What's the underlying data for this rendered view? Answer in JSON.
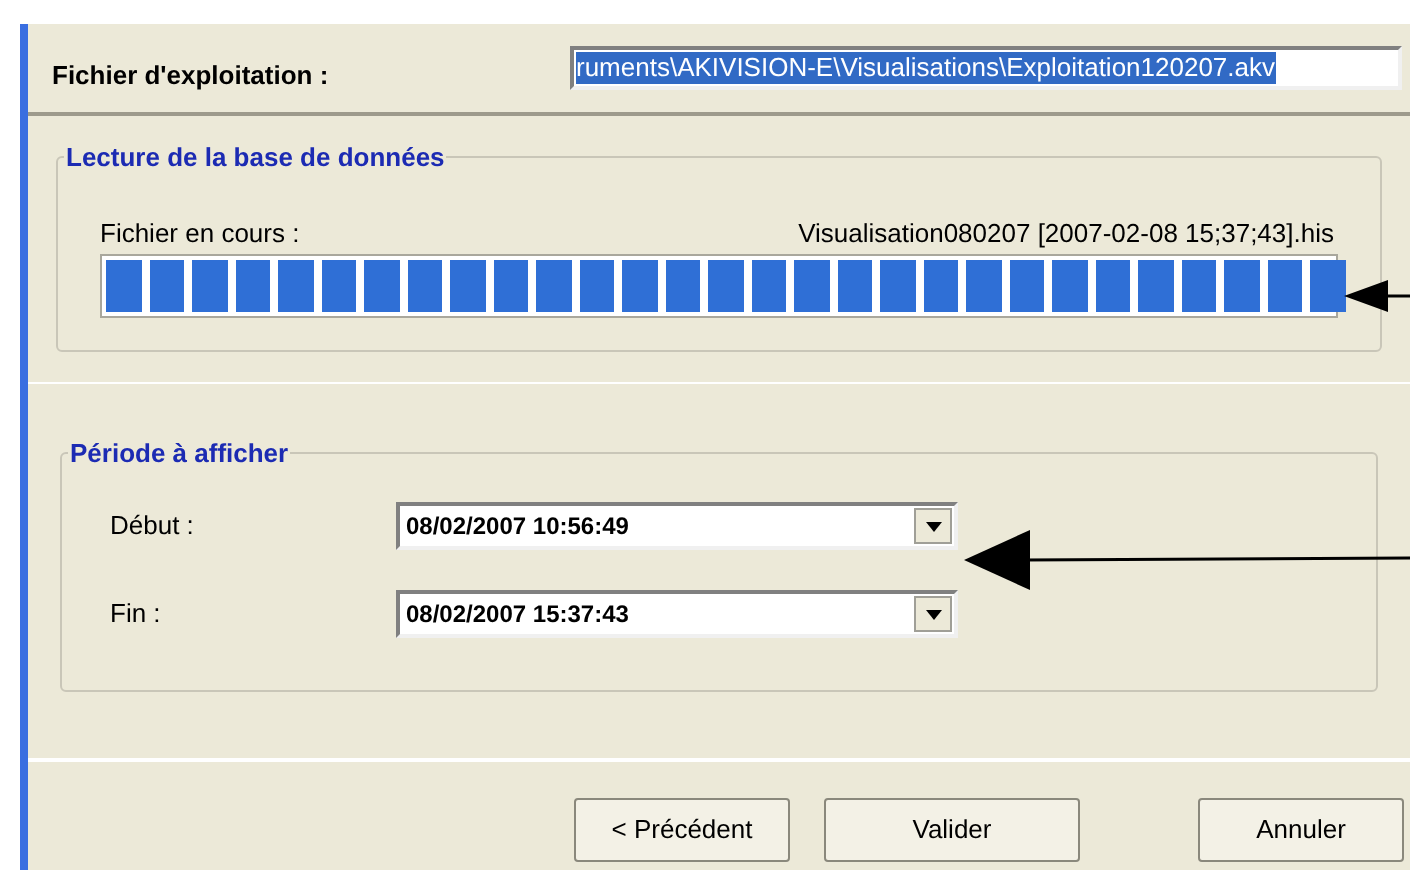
{
  "header": {
    "label": "Fichier d'exploitation :",
    "path_value": "ruments\\AKIVISION-E\\Visualisations\\Exploitation120207.akv",
    "path_selected": true
  },
  "reading_group": {
    "title": "Lecture de la base de données",
    "current_label": "Fichier en cours :",
    "current_file": "Visualisation080207 [2007-02-08 15;37;43].his",
    "progress": {
      "level": 1
    }
  },
  "period_group": {
    "title": "Période à afficher",
    "fields": [
      {
        "label": "Début :",
        "value": "08/02/2007 10:56:49"
      },
      {
        "label": "Fin :",
        "value": "08/02/2007 15:37:43"
      }
    ]
  },
  "buttons": [
    "< Précédent",
    "Valider",
    "Annuler"
  ]
}
